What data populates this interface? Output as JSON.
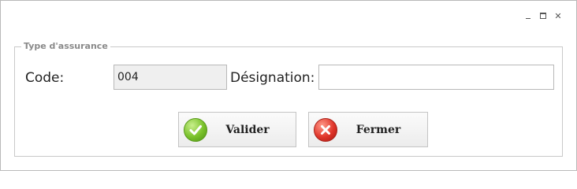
{
  "window_controls": {
    "minimize_icon": "minimize-icon",
    "maximize_icon": "maximize-icon",
    "close_icon": "close-icon",
    "close_glyph": "✕"
  },
  "group": {
    "legend": "Type d'assurance"
  },
  "form": {
    "code_label": "Code:",
    "code_value": "004",
    "designation_label": "Désignation:",
    "designation_value": ""
  },
  "buttons": {
    "valider_label": "Valider",
    "fermer_label": "Fermer"
  },
  "colors": {
    "valider_icon": "#79c12a",
    "fermer_icon": "#e0352a",
    "legend_text": "#8a8a8a"
  }
}
